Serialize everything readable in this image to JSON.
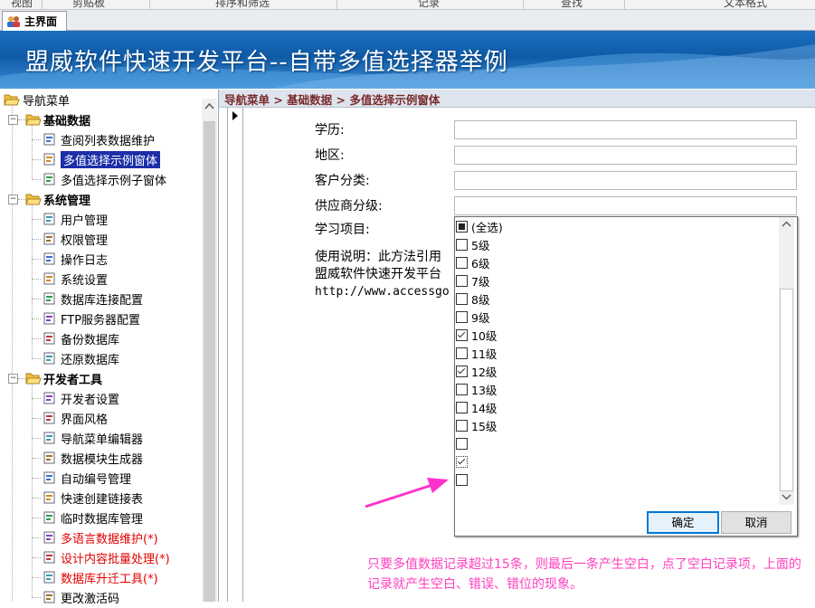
{
  "ribbon": {
    "items": [
      "视图",
      "剪贴板",
      "排序和筛选",
      "记录",
      "查找",
      "文本格式"
    ]
  },
  "tab": {
    "label": "主界面"
  },
  "banner": {
    "title": "盟威软件快速开发平台--自带多值选择器举例"
  },
  "nav": {
    "header": "导航菜单",
    "groups": [
      {
        "label": "基础数据",
        "items": [
          {
            "label": "查阅列表数据维护",
            "icon": "table-icon"
          },
          {
            "label": "多值选择示例窗体",
            "icon": "form-icon",
            "selected": true
          },
          {
            "label": "多值选择示例子窗体",
            "icon": "document-icon"
          }
        ]
      },
      {
        "label": "系统管理",
        "items": [
          {
            "label": "用户管理",
            "icon": "users-icon"
          },
          {
            "label": "权限管理",
            "icon": "lock-icon"
          },
          {
            "label": "操作日志",
            "icon": "log-icon"
          },
          {
            "label": "系统设置",
            "icon": "settings-icon"
          },
          {
            "label": "数据库连接配置",
            "icon": "database-link-icon"
          },
          {
            "label": "FTP服务器配置",
            "icon": "ftp-icon"
          },
          {
            "label": "备份数据库",
            "icon": "backup-icon"
          },
          {
            "label": "还原数据库",
            "icon": "restore-icon"
          }
        ]
      },
      {
        "label": "开发者工具",
        "items": [
          {
            "label": "开发者设置",
            "icon": "dev-settings-icon"
          },
          {
            "label": "界面风格",
            "icon": "style-icon"
          },
          {
            "label": "导航菜单编辑器",
            "icon": "menu-editor-icon"
          },
          {
            "label": "数据模块生成器",
            "icon": "generator-icon"
          },
          {
            "label": "自动编号管理",
            "icon": "numbering-icon"
          },
          {
            "label": "快速创建链接表",
            "icon": "link-icon"
          },
          {
            "label": "临时数据库管理",
            "icon": "temp-db-icon"
          },
          {
            "label": "多语言数据维护(*)",
            "icon": "language-icon",
            "red": true
          },
          {
            "label": "设计内容批量处理(*)",
            "icon": "batch-icon",
            "red": true
          },
          {
            "label": "数据库升迁工具(*)",
            "icon": "upgrade-icon",
            "red": true
          },
          {
            "label": "更改激活码",
            "icon": "key-icon"
          }
        ]
      }
    ]
  },
  "breadcrumb": "导航菜单 > 基础数据 > 多值选择示例窗体",
  "form": {
    "fields": [
      "学历:",
      "地区:",
      "客户分类:",
      "供应商分级:",
      "学习项目:"
    ],
    "usage_line1": "使用说明：此方法引用",
    "usage_line2": "盟威软件快速开发平台",
    "usage_line3": "http://www.accessgo"
  },
  "picker": {
    "items": [
      {
        "label": "(全选)",
        "state": "indeterminate"
      },
      {
        "label": "5级",
        "state": "unchecked"
      },
      {
        "label": "6级",
        "state": "unchecked"
      },
      {
        "label": "7级",
        "state": "unchecked"
      },
      {
        "label": "8级",
        "state": "unchecked"
      },
      {
        "label": "9级",
        "state": "unchecked"
      },
      {
        "label": "10级",
        "state": "checked"
      },
      {
        "label": "11级",
        "state": "unchecked"
      },
      {
        "label": "12级",
        "state": "checked"
      },
      {
        "label": "13级",
        "state": "unchecked"
      },
      {
        "label": "14级",
        "state": "unchecked"
      },
      {
        "label": "15级",
        "state": "unchecked"
      },
      {
        "label": "",
        "state": "unchecked"
      },
      {
        "label": "",
        "state": "checked-focus"
      },
      {
        "label": "",
        "state": "unchecked"
      }
    ],
    "ok_label": "确定",
    "cancel_label": "取消"
  },
  "note": "只要多值数据记录超过15条，则最后一条产生空白，点了空白记录项，上面的记录就产生空白、错误、错位的现象。",
  "colors": {
    "accent": "#1c2fa8",
    "note": "#ff3fbf",
    "arrow": "#ff33cc",
    "banner": "#1b6fc0"
  }
}
